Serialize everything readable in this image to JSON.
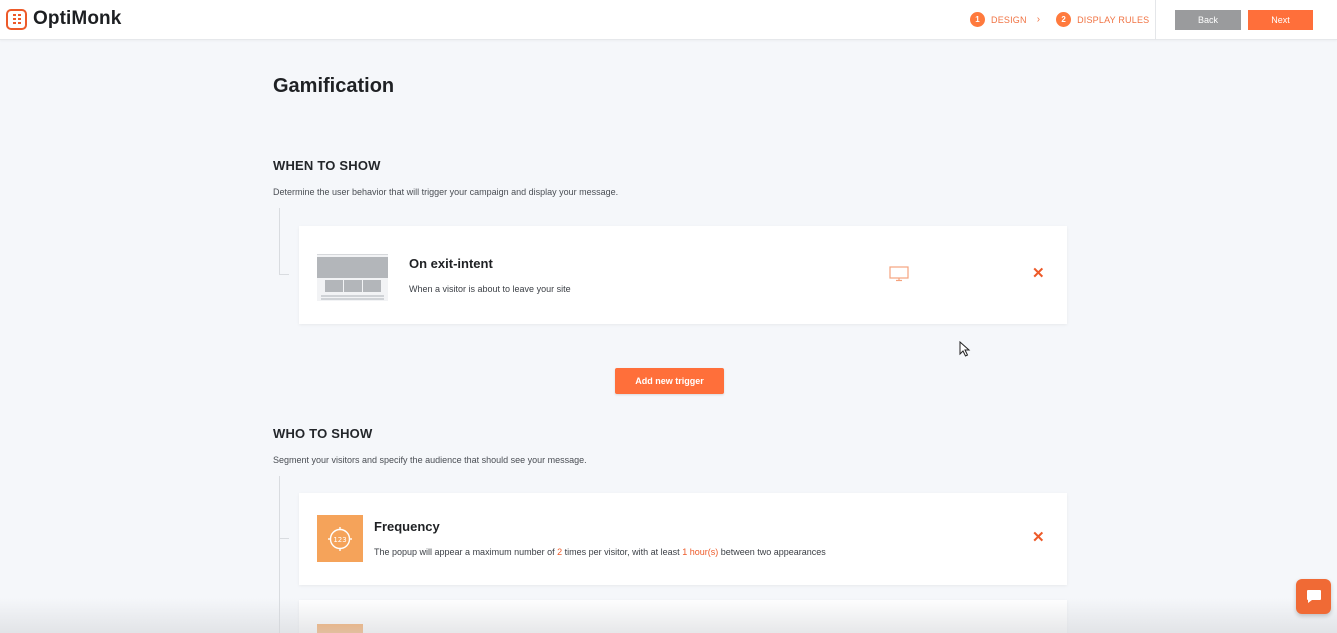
{
  "header": {
    "logo_text": "OptiMonk",
    "steps": [
      {
        "num": "1",
        "label": "DESIGN"
      },
      {
        "num": "2",
        "label": "DISPLAY RULES"
      }
    ],
    "step_separator": "›",
    "back_label": "Back",
    "next_label": "Next"
  },
  "page": {
    "title": "Gamification"
  },
  "when": {
    "title": "WHEN TO SHOW",
    "subtitle": "Determine the user behavior that will trigger your campaign and display your message.",
    "trigger": {
      "title": "On exit-intent",
      "description": "When a visitor is about to leave your site",
      "device_icon": "desktop-icon",
      "remove_icon": "close-icon"
    },
    "add_label": "Add new trigger"
  },
  "who": {
    "title": "WHO TO SHOW",
    "subtitle": "Segment your visitors and specify the audience that should see your message.",
    "frequency": {
      "title": "Frequency",
      "icon_text": "123",
      "desc_before": "The popup will appear a maximum number of",
      "times_value": "2",
      "desc_middle": "times per visitor, with at least",
      "hours_value": "1 hour(s)",
      "desc_after": "between two appearances"
    }
  },
  "colors": {
    "accent": "#ff6f3a",
    "back_button": "#9a9b9d",
    "frequency_icon_bg": "#f5a35a"
  }
}
